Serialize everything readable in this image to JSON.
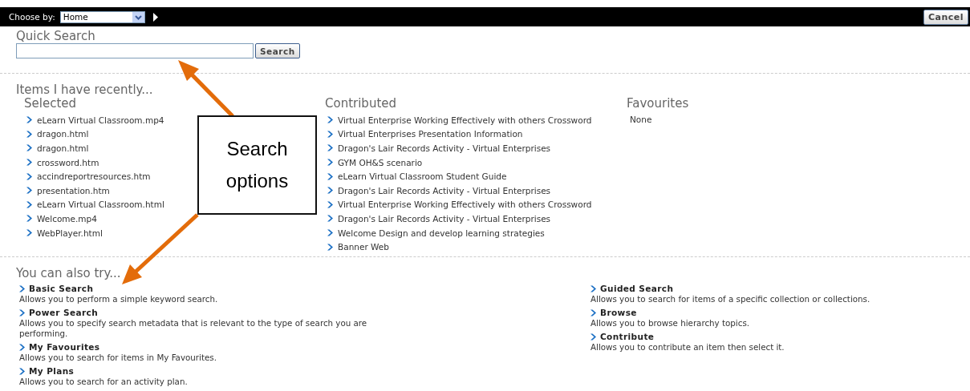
{
  "top_bar": {
    "chooser_label": "Choose by:",
    "chooser_value": "Home",
    "cancel_button": "Cancel"
  },
  "quick_search": {
    "heading": "Quick Search",
    "button": "Search"
  },
  "recent": {
    "heading": "Items I have recently...",
    "columns": [
      {
        "title": "Selected",
        "items": [
          "eLearn Virtual Classroom.mp4",
          "dragon.html",
          "dragon.html",
          "crossword.htm",
          "accindreportresources.htm",
          "presentation.htm",
          "eLearn Virtual Classroom.html",
          "Welcome.mp4",
          "WebPlayer.html"
        ]
      },
      {
        "title": "Contributed",
        "items": [
          "Virtual Enterprise Working Effectively with others Crossword",
          "Virtual Enterprises Presentation Information",
          "Dragon's Lair Records Activity - Virtual Enterprises",
          "GYM OH&S scenario",
          "eLearn Virtual Classroom Student Guide",
          "Dragon's Lair Records Activity - Virtual Enterprises",
          "Virtual Enterprise Working Effectively with others Crossword",
          "Dragon's Lair Records Activity - Virtual Enterprises",
          "Welcome Design and develop learning strategies",
          "Banner Web"
        ]
      },
      {
        "title": "Favourites",
        "empty_text": "None"
      }
    ]
  },
  "also_try": {
    "heading": "You can also try...",
    "columns": [
      [
        {
          "title": "Basic Search",
          "description": "Allows you to perform a simple keyword search."
        },
        {
          "title": "Power Search",
          "description": "Allows you to specify search metadata that is relevant to the type of search you are performing."
        },
        {
          "title": "My Favourites",
          "description": "Allows you to search for items in My Favourites."
        },
        {
          "title": "My Plans",
          "description": "Allows you to search for an activity plan."
        }
      ],
      [
        {
          "title": "Guided Search",
          "description": "Allows you to search for items of a specific collection or collections."
        },
        {
          "title": "Browse",
          "description": "Allows you to browse hierarchy topics."
        },
        {
          "title": "Contribute",
          "description": "Allows you to contribute an item then select it."
        }
      ]
    ]
  },
  "callout": {
    "text": "Search options"
  }
}
